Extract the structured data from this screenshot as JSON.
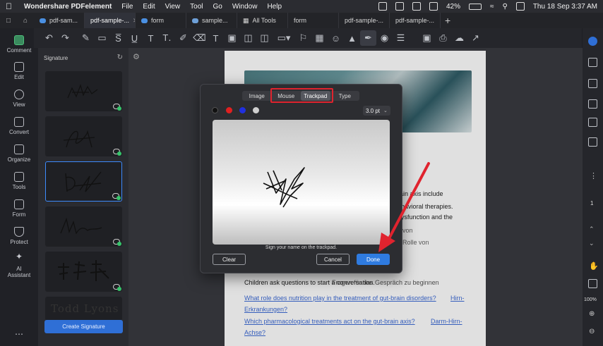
{
  "menubar": {
    "app_name": "Wondershare PDFelement",
    "items": [
      "File",
      "Edit",
      "View",
      "Tool",
      "Go",
      "Window",
      "Help"
    ],
    "battery": "42%",
    "datetime": "Thu 18 Sep  3:37 AM"
  },
  "tabs": [
    {
      "label": "pdf-sam..."
    },
    {
      "label": "pdf-sample-..."
    },
    {
      "label": "form"
    },
    {
      "label": "sample..."
    },
    {
      "label": "All Tools"
    },
    {
      "label": "form"
    },
    {
      "label": "pdf-sample-..."
    },
    {
      "label": "pdf-sample-..."
    }
  ],
  "left_rail": [
    {
      "label": "Comment",
      "icon": "comment-icon"
    },
    {
      "label": "Edit",
      "icon": "edit-icon"
    },
    {
      "label": "View",
      "icon": "eye-icon"
    },
    {
      "label": "Convert",
      "icon": "convert-icon"
    },
    {
      "label": "Organize",
      "icon": "organize-icon"
    },
    {
      "label": "Tools",
      "icon": "toolbox-icon"
    },
    {
      "label": "Form",
      "icon": "form-icon"
    },
    {
      "label": "Protect",
      "icon": "shield-icon"
    },
    {
      "label": "AI Assistant",
      "icon": "ai-wand-icon"
    }
  ],
  "signature_panel": {
    "title": "Signature",
    "create_label": "Create Signature",
    "last_signature_text": "Todd Lyons"
  },
  "document": {
    "lines": [
      {
        "text": "rain axis include"
      },
      {
        "text": "ehavioral therapies."
      },
      {
        "text": "dysfunction and the"
      },
      {
        "text": "von"
      },
      {
        "text": "Rolle von"
      },
      {
        "text": "Children ask questions to start a conversation."
      },
      {
        "text": "Fragen für das Gespräch zu beginnen"
      },
      {
        "text": "What role does nutrition play in the treatment of gut-brain disorders?"
      },
      {
        "text": "Erkrankungen?"
      },
      {
        "text": "Which pharmacological treatments act on the gut-brain axis?"
      },
      {
        "text": "Achse?"
      },
      {
        "text": "Hirn-"
      },
      {
        "text": "Darm-Hirn-"
      }
    ]
  },
  "dialog": {
    "segments": [
      "Image",
      "Mouse",
      "Trackpad",
      "Type"
    ],
    "active_segment": "Trackpad",
    "colors": [
      "#111111",
      "#e02020",
      "#2030e0",
      "#cfcfcf"
    ],
    "pen_size": "3.0 pt",
    "hint": "Sign your name on the trackpad.",
    "clear_label": "Clear",
    "cancel_label": "Cancel",
    "done_label": "Done"
  },
  "right_rail": {
    "page_number": "1",
    "zoom": "100%"
  },
  "annotation_color": "#e0232e"
}
